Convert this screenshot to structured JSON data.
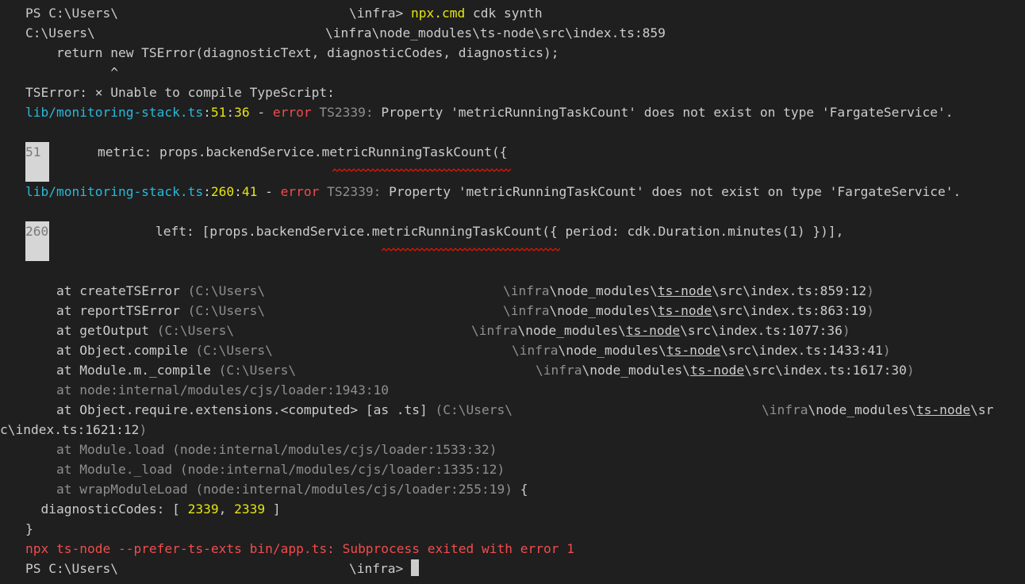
{
  "prompt": {
    "ps": "PS C:\\Users\\",
    "path_tail": "\\infra>",
    "exe": "npx.cmd",
    "args": " cdk synth"
  },
  "error_origin": {
    "file_prefix": "C:\\Users\\",
    "file_tail": "\\infra\\node_modules\\ts-node\\src\\index.ts:859",
    "code": "    return new TSError(diagnosticText, diagnosticCodes, diagnostics);",
    "caret": "           ^"
  },
  "tserror": {
    "label": "TSError: ",
    "mark": "×",
    "message": " Unable to compile TypeScript:"
  },
  "diagnostics": [
    {
      "file": "lib/monitoring-stack.ts",
      "sep1": ":",
      "line": "51",
      "sep2": ":",
      "col": "36",
      "dash": " - ",
      "error_word": "error",
      "code": " TS2339:",
      "message": " Property 'metricRunningTaskCount' does not exist on type 'FargateService'.",
      "gutter": "51",
      "source": "metric: props.backendService.metricRunningTaskCount({"
    },
    {
      "file": "lib/monitoring-stack.ts",
      "sep1": ":",
      "line": "260",
      "sep2": ":",
      "col": "41",
      "dash": " - ",
      "error_word": "error",
      "code": " TS2339:",
      "message": " Property 'metricRunningTaskCount' does not exist on type 'FargateService'.",
      "gutter": "260",
      "source": "left: [props.backendService.metricRunningTaskCount({ period: cdk.Duration.minutes(1) })],"
    }
  ],
  "stack": [
    {
      "at": "    at ",
      "fn": "createTSError",
      "open": " (C:\\Users\\",
      "mid": "\\infra",
      "nm": "\\node_modules\\",
      "tsn": "ts-node",
      "rest": "\\src\\index.ts:859:12",
      "close": ")"
    },
    {
      "at": "    at ",
      "fn": "reportTSError",
      "open": " (C:\\Users\\",
      "mid": "\\infra",
      "nm": "\\node_modules\\",
      "tsn": "ts-node",
      "rest": "\\src\\index.ts:863:19",
      "close": ")"
    },
    {
      "at": "    at ",
      "fn": "getOutput",
      "open": " (C:\\Users\\",
      "mid": "\\infra",
      "nm": "\\node_modules\\",
      "tsn": "ts-node",
      "rest": "\\src\\index.ts:1077:36",
      "close": ")"
    },
    {
      "at": "    at ",
      "fn": "Object.compile",
      "open": " (C:\\Users\\",
      "mid": "\\infra",
      "nm": "\\node_modules\\",
      "tsn": "ts-node",
      "rest": "\\src\\index.ts:1433:41",
      "close": ")"
    },
    {
      "at": "    at ",
      "fn": "Module.m._compile",
      "open": " (C:\\Users\\",
      "mid": "\\infra",
      "nm": "\\node_modules\\",
      "tsn": "ts-node",
      "rest": "\\src\\index.ts:1617:30",
      "close": ")"
    }
  ],
  "internal1": "    at node:internal/modules/cjs/loader:1943:10",
  "require_ext": {
    "at": "    at ",
    "fn": "Object.require.extensions.<computed> [as .ts]",
    "open": " (C:\\Users\\",
    "mid": "\\infra",
    "nm": "\\node_modules\\",
    "tsn": "ts-node",
    "tail1": "\\sr",
    "wrap": "c\\index.ts:1621:12",
    "close": ")"
  },
  "internal_more": [
    {
      "at": "    at ",
      "fn": "Module.load",
      "rest": " (node:internal/modules/cjs/loader:1533:32)"
    },
    {
      "at": "    at ",
      "fn": "Module._load",
      "rest": " (node:internal/modules/cjs/loader:1335:12)"
    },
    {
      "at": "    at ",
      "fn": "wrapModuleLoad",
      "rest": " (node:internal/modules/cjs/loader:255:19)",
      "brace": " {"
    }
  ],
  "diag_codes": {
    "label": "  diagnosticCodes: [ ",
    "a": "2339",
    "comma": ", ",
    "b": "2339",
    "end": " ]"
  },
  "close_brace": "}",
  "exit_msg": "npx ts-node --prefer-ts-exts bin/app.ts: Subprocess exited with error 1",
  "prompt2": {
    "ps": "PS C:\\Users\\",
    "path_tail": "\\infra>"
  },
  "colors": {
    "background": "#1f1f1f",
    "yellow": "#e5e510",
    "cyan": "#29b8db",
    "red": "#f14c4c",
    "squiggle": "#e51400"
  }
}
